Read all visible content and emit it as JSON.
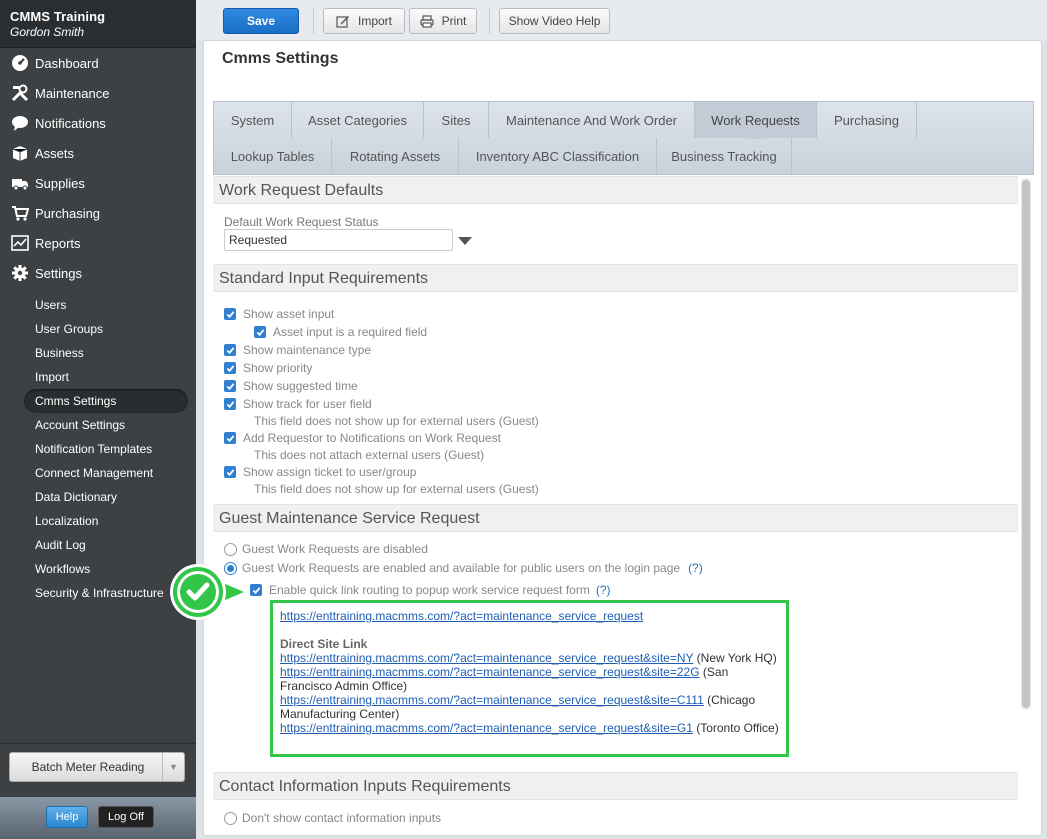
{
  "sidebar": {
    "app_title": "CMMS Training",
    "user_name": "Gordon Smith",
    "nav": [
      {
        "label": "Dashboard",
        "icon": "dashboard-icon"
      },
      {
        "label": "Maintenance",
        "icon": "tools-icon"
      },
      {
        "label": "Notifications",
        "icon": "chat-bubble-icon"
      },
      {
        "label": "Assets",
        "icon": "box-icon"
      },
      {
        "label": "Supplies",
        "icon": "truck-icon"
      },
      {
        "label": "Purchasing",
        "icon": "cart-icon"
      },
      {
        "label": "Reports",
        "icon": "chart-icon"
      },
      {
        "label": "Settings",
        "icon": "gear-icon"
      }
    ],
    "sub_items": [
      "Users",
      "User Groups",
      "Business",
      "Import",
      "Cmms Settings",
      "Account Settings",
      "Notification Templates",
      "Connect Management",
      "Data Dictionary",
      "Localization",
      "Audit Log",
      "Workflows",
      "Security & Infrastructure"
    ],
    "active_sub_item": "Cmms Settings",
    "batch_button": "Batch Meter Reading",
    "help_button": "Help",
    "logoff_button": "Log Off"
  },
  "toolbar": {
    "save": "Save",
    "import": "Import",
    "print": "Print",
    "video": "Show Video Help"
  },
  "page": {
    "title": "Cmms Settings",
    "tabs_row1": [
      "System",
      "Asset Categories",
      "Sites",
      "Maintenance And Work Order",
      "Work Requests",
      "Purchasing"
    ],
    "tabs_row2": [
      "Lookup Tables",
      "Rotating Assets",
      "Inventory ABC Classification",
      "Business Tracking"
    ],
    "active_tab": "Work Requests"
  },
  "work_request_defaults": {
    "heading": "Work Request Defaults",
    "status_label": "Default Work Request Status",
    "status_value": "Requested"
  },
  "standard_inputs": {
    "heading": "Standard Input Requirements",
    "show_asset": "Show asset input",
    "asset_required": "Asset input is a required field",
    "show_maint_type": "Show maintenance type",
    "show_priority": "Show priority",
    "show_suggested_time": "Show suggested time",
    "show_track": "Show track for user field",
    "track_note": "This field does not show up for external users (Guest)",
    "add_requestor": "Add Requestor to Notifications on Work Request",
    "requestor_note": "This does not attach external users (Guest)",
    "show_assign": "Show assign ticket to user/group",
    "assign_note": "This field does not show up for external users (Guest)"
  },
  "guest_request": {
    "heading": "Guest Maintenance Service Request",
    "disabled": "Guest Work Requests are disabled",
    "enabled": "Guest Work Requests are enabled and available for public users on the login page",
    "help": "(?)",
    "quick_link": "Enable quick link routing to popup work service request form",
    "main_link": "https://enttraining.macmms.com/?act=maintenance_service_request",
    "direct_site_link_label": "Direct Site Link",
    "site_links": [
      {
        "url": "https://enttraining.macmms.com/?act=maintenance_service_request&site=NY",
        "site": "(New York HQ)"
      },
      {
        "url": "https://enttraining.macmms.com/?act=maintenance_service_request&site=22G",
        "site": "(San Francisco Admin Office)"
      },
      {
        "url": "https://enttraining.macmms.com/?act=maintenance_service_request&site=C111",
        "site": "(Chicago Manufacturing Center)"
      },
      {
        "url": "https://enttraining.macmms.com/?act=maintenance_service_request&site=G1",
        "site": "(Toronto Office)"
      }
    ]
  },
  "contact_info": {
    "heading": "Contact Information Inputs Requirements",
    "dont_show": "Don't show contact information inputs"
  },
  "colors": {
    "accent": "#2f80d0",
    "highlight_green": "#33c44a",
    "sidebar_bg": "#3d4144"
  }
}
